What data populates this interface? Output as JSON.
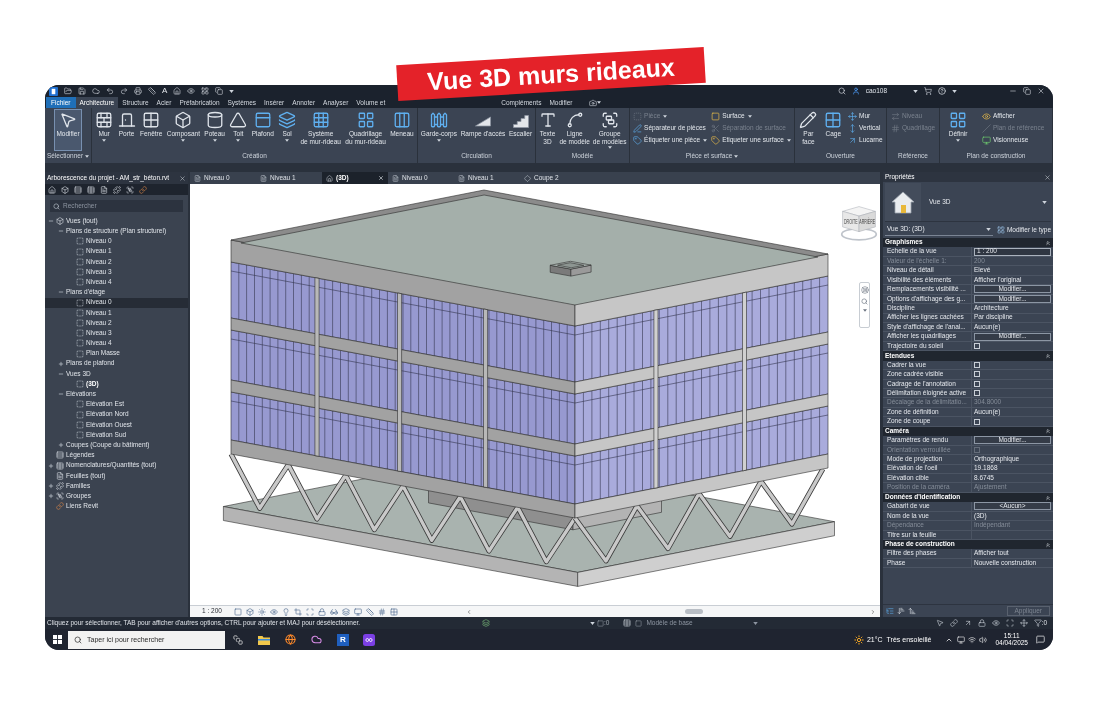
{
  "banner": {
    "title": "Vue 3D murs rideaux"
  },
  "title_bar": {
    "text_tool_glyph": "A",
    "user": "cao108"
  },
  "ribbon_tabs": [
    {
      "label": "Fichier",
      "kind": "file",
      "selected": false
    },
    {
      "label": "Architecture",
      "kind": "tab",
      "selected": true
    },
    {
      "label": "Structure",
      "kind": "tab",
      "selected": false
    },
    {
      "label": "Acier",
      "kind": "tab",
      "selected": false
    },
    {
      "label": "Préfabrication",
      "kind": "tab",
      "selected": false
    },
    {
      "label": "Systèmes",
      "kind": "tab",
      "selected": false
    },
    {
      "label": "Insérer",
      "kind": "tab",
      "selected": false
    },
    {
      "label": "Annoter",
      "kind": "tab",
      "selected": false
    },
    {
      "label": "Analyser",
      "kind": "tab",
      "selected": false
    },
    {
      "label": "Volume et",
      "kind": "tab",
      "selected": false
    },
    {
      "label": "Compléments",
      "kind": "tab",
      "selected": false
    },
    {
      "label": "Modifier",
      "kind": "tab",
      "selected": false
    }
  ],
  "ribbon_panels": [
    {
      "label": "Sélectionner",
      "dropdown": true,
      "tools": [
        {
          "kind": "large",
          "lines": [
            "Modifier"
          ],
          "dropdown": false,
          "disabled": false,
          "active": true
        }
      ]
    },
    {
      "label": "Création",
      "dropdown": false,
      "tools": [
        {
          "kind": "large",
          "lines": [
            "Mur"
          ],
          "dropdown": true,
          "disabled": false
        },
        {
          "kind": "large",
          "lines": [
            "Porte"
          ],
          "dropdown": false,
          "disabled": false
        },
        {
          "kind": "large",
          "lines": [
            "Fenêtre"
          ],
          "dropdown": false,
          "disabled": false
        },
        {
          "kind": "large",
          "lines": [
            "Composant"
          ],
          "dropdown": true,
          "disabled": false
        },
        {
          "kind": "large",
          "lines": [
            "Poteau"
          ],
          "dropdown": true,
          "disabled": false
        },
        {
          "kind": "large",
          "lines": [
            "Toit"
          ],
          "dropdown": true,
          "disabled": false
        },
        {
          "kind": "large",
          "lines": [
            "Plafond"
          ],
          "dropdown": false,
          "disabled": false
        },
        {
          "kind": "large",
          "lines": [
            "Sol"
          ],
          "dropdown": true,
          "disabled": false
        },
        {
          "kind": "large",
          "lines": [
            "Système",
            "de mur-rideau"
          ],
          "dropdown": false,
          "disabled": false
        },
        {
          "kind": "large",
          "lines": [
            "Quadrillage",
            "du mur-rideau"
          ],
          "dropdown": false,
          "disabled": false
        },
        {
          "kind": "large",
          "lines": [
            "Meneau"
          ],
          "dropdown": false,
          "disabled": false
        }
      ]
    },
    {
      "label": "Circulation",
      "dropdown": false,
      "tools": [
        {
          "kind": "large",
          "lines": [
            "Garde-corps"
          ],
          "dropdown": true,
          "disabled": false
        },
        {
          "kind": "large",
          "lines": [
            "Rampe d'accès"
          ],
          "dropdown": false,
          "disabled": false
        },
        {
          "kind": "large",
          "lines": [
            "Escalier"
          ],
          "dropdown": false,
          "disabled": false
        }
      ]
    },
    {
      "label": "Modèle",
      "dropdown": false,
      "tools": [
        {
          "kind": "large",
          "lines": [
            "Texte",
            "3D"
          ],
          "dropdown": false,
          "disabled": false
        },
        {
          "kind": "large",
          "lines": [
            "Ligne",
            "de modèle"
          ],
          "dropdown": false,
          "disabled": false
        },
        {
          "kind": "large",
          "lines": [
            "Groupe",
            "de modèles"
          ],
          "dropdown": true,
          "disabled": false
        }
      ]
    },
    {
      "label": "Pièce et surface",
      "dropdown": true,
      "tools": [
        {
          "kind": "small",
          "label": "Pièce",
          "dropdown": true,
          "disabled": true
        },
        {
          "kind": "small",
          "label": "Séparateur de pièces",
          "dropdown": false,
          "disabled": false
        },
        {
          "kind": "small",
          "label": "Étiqueter une pièce",
          "dropdown": true,
          "disabled": false
        },
        {
          "kind": "small",
          "label": "Surface",
          "dropdown": true,
          "disabled": false
        },
        {
          "kind": "small",
          "label": "Séparation de surface",
          "dropdown": false,
          "disabled": true
        },
        {
          "kind": "small",
          "label": "Etiqueter une surface",
          "dropdown": true,
          "disabled": false
        }
      ]
    },
    {
      "label": "Ouverture",
      "dropdown": false,
      "tools": [
        {
          "kind": "large",
          "lines": [
            "Par",
            "face"
          ],
          "dropdown": false,
          "disabled": false
        },
        {
          "kind": "large",
          "lines": [
            "Cage"
          ],
          "dropdown": false,
          "disabled": false
        },
        {
          "kind": "small",
          "label": "Mur",
          "dropdown": false,
          "disabled": false
        },
        {
          "kind": "small",
          "label": "Vertical",
          "dropdown": false,
          "disabled": false
        },
        {
          "kind": "small",
          "label": "Lucarne",
          "dropdown": false,
          "disabled": false
        }
      ]
    },
    {
      "label": "Référence",
      "dropdown": false,
      "tools": [
        {
          "kind": "small",
          "label": "Niveau",
          "dropdown": false,
          "disabled": true
        },
        {
          "kind": "small",
          "label": "Quadrillage",
          "dropdown": false,
          "disabled": true
        }
      ]
    },
    {
      "label": "Plan de construction",
      "dropdown": false,
      "tools": [
        {
          "kind": "large",
          "lines": [
            "Définir"
          ],
          "dropdown": true,
          "disabled": false
        },
        {
          "kind": "small",
          "label": "Afficher",
          "dropdown": false,
          "disabled": false
        },
        {
          "kind": "small",
          "label": "Plan de référence",
          "dropdown": false,
          "disabled": true
        },
        {
          "kind": "small",
          "label": "Visionneuse",
          "dropdown": false,
          "disabled": false
        }
      ]
    }
  ],
  "project_browser": {
    "title": "Arborescence du projet - AM_str_béton.rvt",
    "search": {
      "placeholder": "Rechercher"
    },
    "tree": [
      {
        "label": "Vues (tout)",
        "kind": "views",
        "expanded": true,
        "selected": false,
        "current": false,
        "children": [
          {
            "label": "Plans de structure (Plan structurel)",
            "expanded": true,
            "selected": false,
            "current": false,
            "children": [
              {
                "label": "Niveau 0",
                "kind": "view",
                "selected": false,
                "current": false
              },
              {
                "label": "Niveau 1",
                "kind": "view",
                "selected": false,
                "current": false
              },
              {
                "label": "Niveau 2",
                "kind": "view",
                "selected": false,
                "current": false
              },
              {
                "label": "Niveau 3",
                "kind": "view",
                "selected": false,
                "current": false
              },
              {
                "label": "Niveau 4",
                "kind": "view",
                "selected": false,
                "current": false
              }
            ]
          },
          {
            "label": "Plans d'étage",
            "expanded": true,
            "selected": false,
            "current": false,
            "children": [
              {
                "label": "Niveau 0",
                "kind": "view",
                "selected": true,
                "current": false
              },
              {
                "label": "Niveau 1",
                "kind": "view",
                "selected": false,
                "current": false
              },
              {
                "label": "Niveau 2",
                "kind": "view",
                "selected": false,
                "current": false
              },
              {
                "label": "Niveau 3",
                "kind": "view",
                "selected": false,
                "current": false
              },
              {
                "label": "Niveau 4",
                "kind": "view",
                "selected": false,
                "current": false
              },
              {
                "label": "Plan Masse",
                "kind": "view",
                "selected": false,
                "current": false
              }
            ]
          },
          {
            "label": "Plans de plafond",
            "expanded": false,
            "selected": false,
            "current": false
          },
          {
            "label": "Vues 3D",
            "expanded": true,
            "selected": false,
            "current": false,
            "children": [
              {
                "label": "(3D)",
                "kind": "view",
                "selected": false,
                "current": true
              }
            ]
          },
          {
            "label": "Elévations",
            "expanded": true,
            "selected": false,
            "current": false,
            "children": [
              {
                "label": "Elévation Est",
                "kind": "view",
                "selected": false,
                "current": false
              },
              {
                "label": "Elévation Nord",
                "kind": "view",
                "selected": false,
                "current": false
              },
              {
                "label": "Elévation Ouest",
                "kind": "view",
                "selected": false,
                "current": false
              },
              {
                "label": "Elévation Sud",
                "kind": "view",
                "selected": false,
                "current": false
              }
            ]
          },
          {
            "label": "Coupes (Coupe du bâtiment)",
            "expanded": false,
            "selected": false,
            "current": false
          }
        ]
      },
      {
        "label": "Légendes",
        "kind": "legend",
        "selected": false,
        "current": false
      },
      {
        "label": "Nomenclatures/Quantités (tout)",
        "kind": "schedule",
        "expanded": false,
        "selected": false,
        "current": false
      },
      {
        "label": "Feuilles (tout)",
        "kind": "sheet",
        "selected": false,
        "current": false
      },
      {
        "label": "Familles",
        "kind": "family",
        "expanded": false,
        "selected": false,
        "current": false
      },
      {
        "label": "Groupes",
        "kind": "group",
        "expanded": false,
        "selected": false,
        "current": false
      },
      {
        "label": "Liens Revit",
        "kind": "link",
        "selected": false,
        "current": false
      }
    ]
  },
  "view_area": {
    "tabs": [
      {
        "label": "Niveau 0",
        "kind": "plan",
        "selected": false
      },
      {
        "label": "Niveau 1",
        "kind": "plan",
        "selected": false
      },
      {
        "label": "(3D)",
        "kind": "perspective",
        "selected": true
      },
      {
        "label": "Niveau 0",
        "kind": "plan",
        "selected": false
      },
      {
        "label": "Niveau 1",
        "kind": "plan",
        "selected": false
      },
      {
        "label": "Coupe 2",
        "kind": "section",
        "selected": false
      }
    ],
    "view_cube": {
      "faces": [
        "DROITE",
        "ARRIÈRE"
      ]
    },
    "scale": "1 : 200"
  },
  "properties": {
    "title": "Propriétés",
    "type_name": "Vue 3D",
    "instance": "Vue 3D: (3D)",
    "edit_type": "Modifier le type",
    "groups": [
      {
        "label": "Graphismes",
        "expanded": true,
        "rows": [
          {
            "name": "Echelle de la vue",
            "kind": "field",
            "value": "1 : 200",
            "disabled": false
          },
          {
            "name": "Valeur de l'échelle 1:",
            "kind": "text",
            "value": "200",
            "disabled": true
          },
          {
            "name": "Niveau de détail",
            "kind": "text",
            "value": "Elevé",
            "disabled": false
          },
          {
            "name": "Visibilité des éléments",
            "kind": "text",
            "value": "Afficher l'original",
            "disabled": false
          },
          {
            "name": "Remplacements visibilité ...",
            "kind": "button",
            "value": "Modifier...",
            "disabled": false
          },
          {
            "name": "Options d'affichage des g...",
            "kind": "button",
            "value": "Modifier...",
            "disabled": false
          },
          {
            "name": "Discipline",
            "kind": "text",
            "value": "Architecture",
            "disabled": false
          },
          {
            "name": "Afficher les lignes cachées",
            "kind": "text",
            "value": "Par discipline",
            "disabled": false
          },
          {
            "name": "Style d'affichage de l'anal...",
            "kind": "text",
            "value": "Aucun(e)",
            "disabled": false
          },
          {
            "name": "Afficher les quadrillages",
            "kind": "button",
            "value": "Modifier...",
            "disabled": false
          },
          {
            "name": "Trajectoire du soleil",
            "kind": "checkbox",
            "checked": false,
            "disabled": false
          }
        ]
      },
      {
        "label": "Etendues",
        "expanded": true,
        "rows": [
          {
            "name": "Cadrer la vue",
            "kind": "checkbox",
            "checked": false,
            "disabled": false
          },
          {
            "name": "Zone cadrée visible",
            "kind": "checkbox",
            "checked": false,
            "disabled": false
          },
          {
            "name": "Cadrage de l'annotation",
            "kind": "checkbox",
            "checked": false,
            "disabled": false
          },
          {
            "name": "Délimitation éloignée active",
            "kind": "checkbox",
            "checked": false,
            "disabled": false
          },
          {
            "name": "Décalage de la délimitatio...",
            "kind": "text",
            "value": "304.8000",
            "disabled": true
          },
          {
            "name": "Zone de définition",
            "kind": "text",
            "value": "Aucun(e)",
            "disabled": false
          },
          {
            "name": "Zone de coupe",
            "kind": "checkbox",
            "checked": false,
            "disabled": false
          }
        ]
      },
      {
        "label": "Caméra",
        "expanded": true,
        "rows": [
          {
            "name": "Paramètres de rendu",
            "kind": "button",
            "value": "Modifier...",
            "disabled": false
          },
          {
            "name": "Orientation verrouillée",
            "kind": "checkbox",
            "checked": false,
            "disabled": true
          },
          {
            "name": "Mode de projection",
            "kind": "text",
            "value": "Orthographique",
            "disabled": false
          },
          {
            "name": "Elévation de l'oeil",
            "kind": "text",
            "value": "19.1868",
            "disabled": false
          },
          {
            "name": "Elévation cible",
            "kind": "text",
            "value": "8.6745",
            "disabled": false
          },
          {
            "name": "Position de la caméra",
            "kind": "text",
            "value": "Ajustement",
            "disabled": true
          }
        ]
      },
      {
        "label": "Données d'identification",
        "expanded": true,
        "rows": [
          {
            "name": "Gabarit de vue",
            "kind": "button",
            "value": "<Aucun>",
            "disabled": false
          },
          {
            "name": "Nom de la vue",
            "kind": "text",
            "value": "(3D)",
            "disabled": false
          },
          {
            "name": "Dépendance",
            "kind": "text",
            "value": "Indépendant",
            "disabled": true
          },
          {
            "name": "Titre sur la feuille",
            "kind": "text",
            "disabled": false
          }
        ]
      },
      {
        "label": "Phase de construction",
        "expanded": true,
        "rows": [
          {
            "name": "Filtre des phases",
            "kind": "text",
            "value": "Afficher tout",
            "disabled": false
          },
          {
            "name": "Phase",
            "kind": "text",
            "value": "Nouvelle construction",
            "disabled": false
          }
        ]
      }
    ],
    "apply": {
      "label": "Appliquer",
      "disabled": true
    }
  },
  "status_bar": {
    "message": "Cliquez pour sélectionner, TAB pour afficher d'autres options, CTRL pour ajouter et MAJ pour désélectionner.",
    "selection_count": ":0",
    "model": "Modèle de base",
    "filter_count": ":0"
  },
  "taskbar": {
    "search": {
      "placeholder": "Taper ici pour rechercher"
    },
    "app_tile_letter": "R",
    "weather": {
      "temperature": "21°C",
      "condition": "Très ensoleillé"
    },
    "time": "15:11",
    "date": "04/04/2025"
  }
}
